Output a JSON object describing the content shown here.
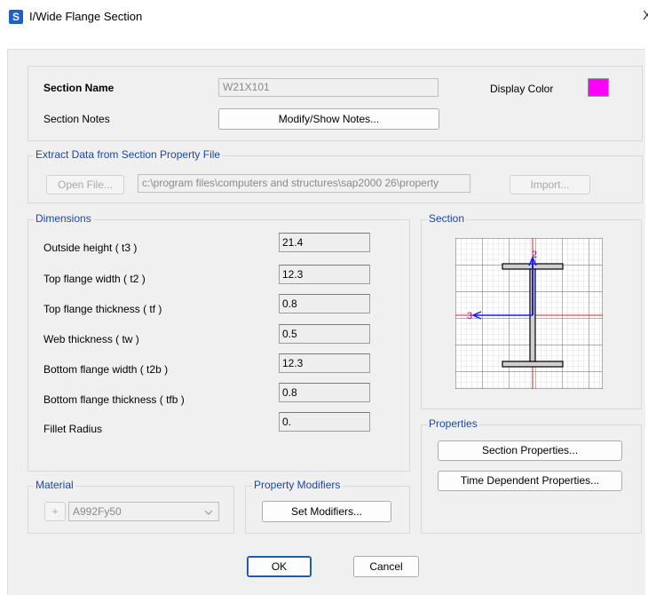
{
  "window": {
    "title": "I/Wide Flange Section",
    "app_icon_letter": "S",
    "close_glyph": "X"
  },
  "section": {
    "name_label": "Section Name",
    "name_value": "W21X101",
    "display_color_label": "Display Color",
    "display_color": "#ff00ff",
    "notes_label": "Section Notes",
    "notes_button": "Modify/Show Notes..."
  },
  "extract": {
    "legend": "Extract Data from Section Property File",
    "open_button": "Open File...",
    "path": "c:\\program files\\computers and structures\\sap2000 26\\property",
    "import_button": "Import..."
  },
  "dimensions": {
    "legend": "Dimensions",
    "rows": [
      {
        "label": "Outside height  ( t3 )",
        "value": "21.4"
      },
      {
        "label": "Top flange width  ( t2 )",
        "value": "12.3"
      },
      {
        "label": "Top flange thickness  ( tf )",
        "value": "0.8"
      },
      {
        "label": "Web thickness  ( tw )",
        "value": "0.5"
      },
      {
        "label": "Bottom flange width  ( t2b )",
        "value": "12.3"
      },
      {
        "label": "Bottom flange thickness  ( tfb )",
        "value": "0.8"
      },
      {
        "label": "Fillet Radius",
        "value": "0."
      }
    ]
  },
  "section_preview": {
    "legend": "Section",
    "axis2": "2",
    "axis3": "3"
  },
  "properties": {
    "legend": "Properties",
    "section_properties_button": "Section Properties...",
    "time_dependent_button": "Time Dependent Properties..."
  },
  "material": {
    "legend": "Material",
    "add_glyph": "+",
    "value": "A992Fy50"
  },
  "modifiers": {
    "legend": "Property Modifiers",
    "button": "Set Modifiers..."
  },
  "footer": {
    "ok": "OK",
    "cancel": "Cancel"
  }
}
